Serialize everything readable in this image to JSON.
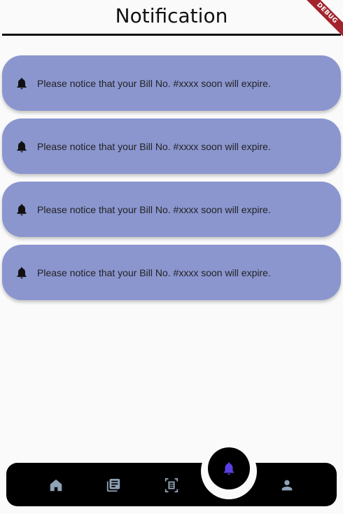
{
  "header": {
    "title": "Notification"
  },
  "debug_banner": {
    "label": "DEBUG"
  },
  "notifications": [
    {
      "icon": "bell-icon",
      "message": "Please notice that your Bill No. #xxxx soon will expire."
    },
    {
      "icon": "bell-icon",
      "message": "Please notice that your Bill No. #xxxx soon will expire."
    },
    {
      "icon": "bell-icon",
      "message": "Please notice that your Bill No. #xxxx soon will expire."
    },
    {
      "icon": "bell-icon",
      "message": "Please notice that your Bill No. #xxxx soon will expire."
    }
  ],
  "bottom_nav": {
    "items": [
      {
        "icon": "home-icon",
        "active": false
      },
      {
        "icon": "library-books-icon",
        "active": false
      },
      {
        "icon": "document-scanner-icon",
        "active": false
      },
      {
        "icon": "bell-icon",
        "active": true
      },
      {
        "icon": "person-icon",
        "active": false
      }
    ]
  },
  "colors": {
    "card_background": "#8b96cf",
    "nav_background": "#000000",
    "nav_icon_inactive": "#8fa3b8",
    "nav_icon_active": "#5b3fe0",
    "debug_ribbon": "#a3242d"
  }
}
